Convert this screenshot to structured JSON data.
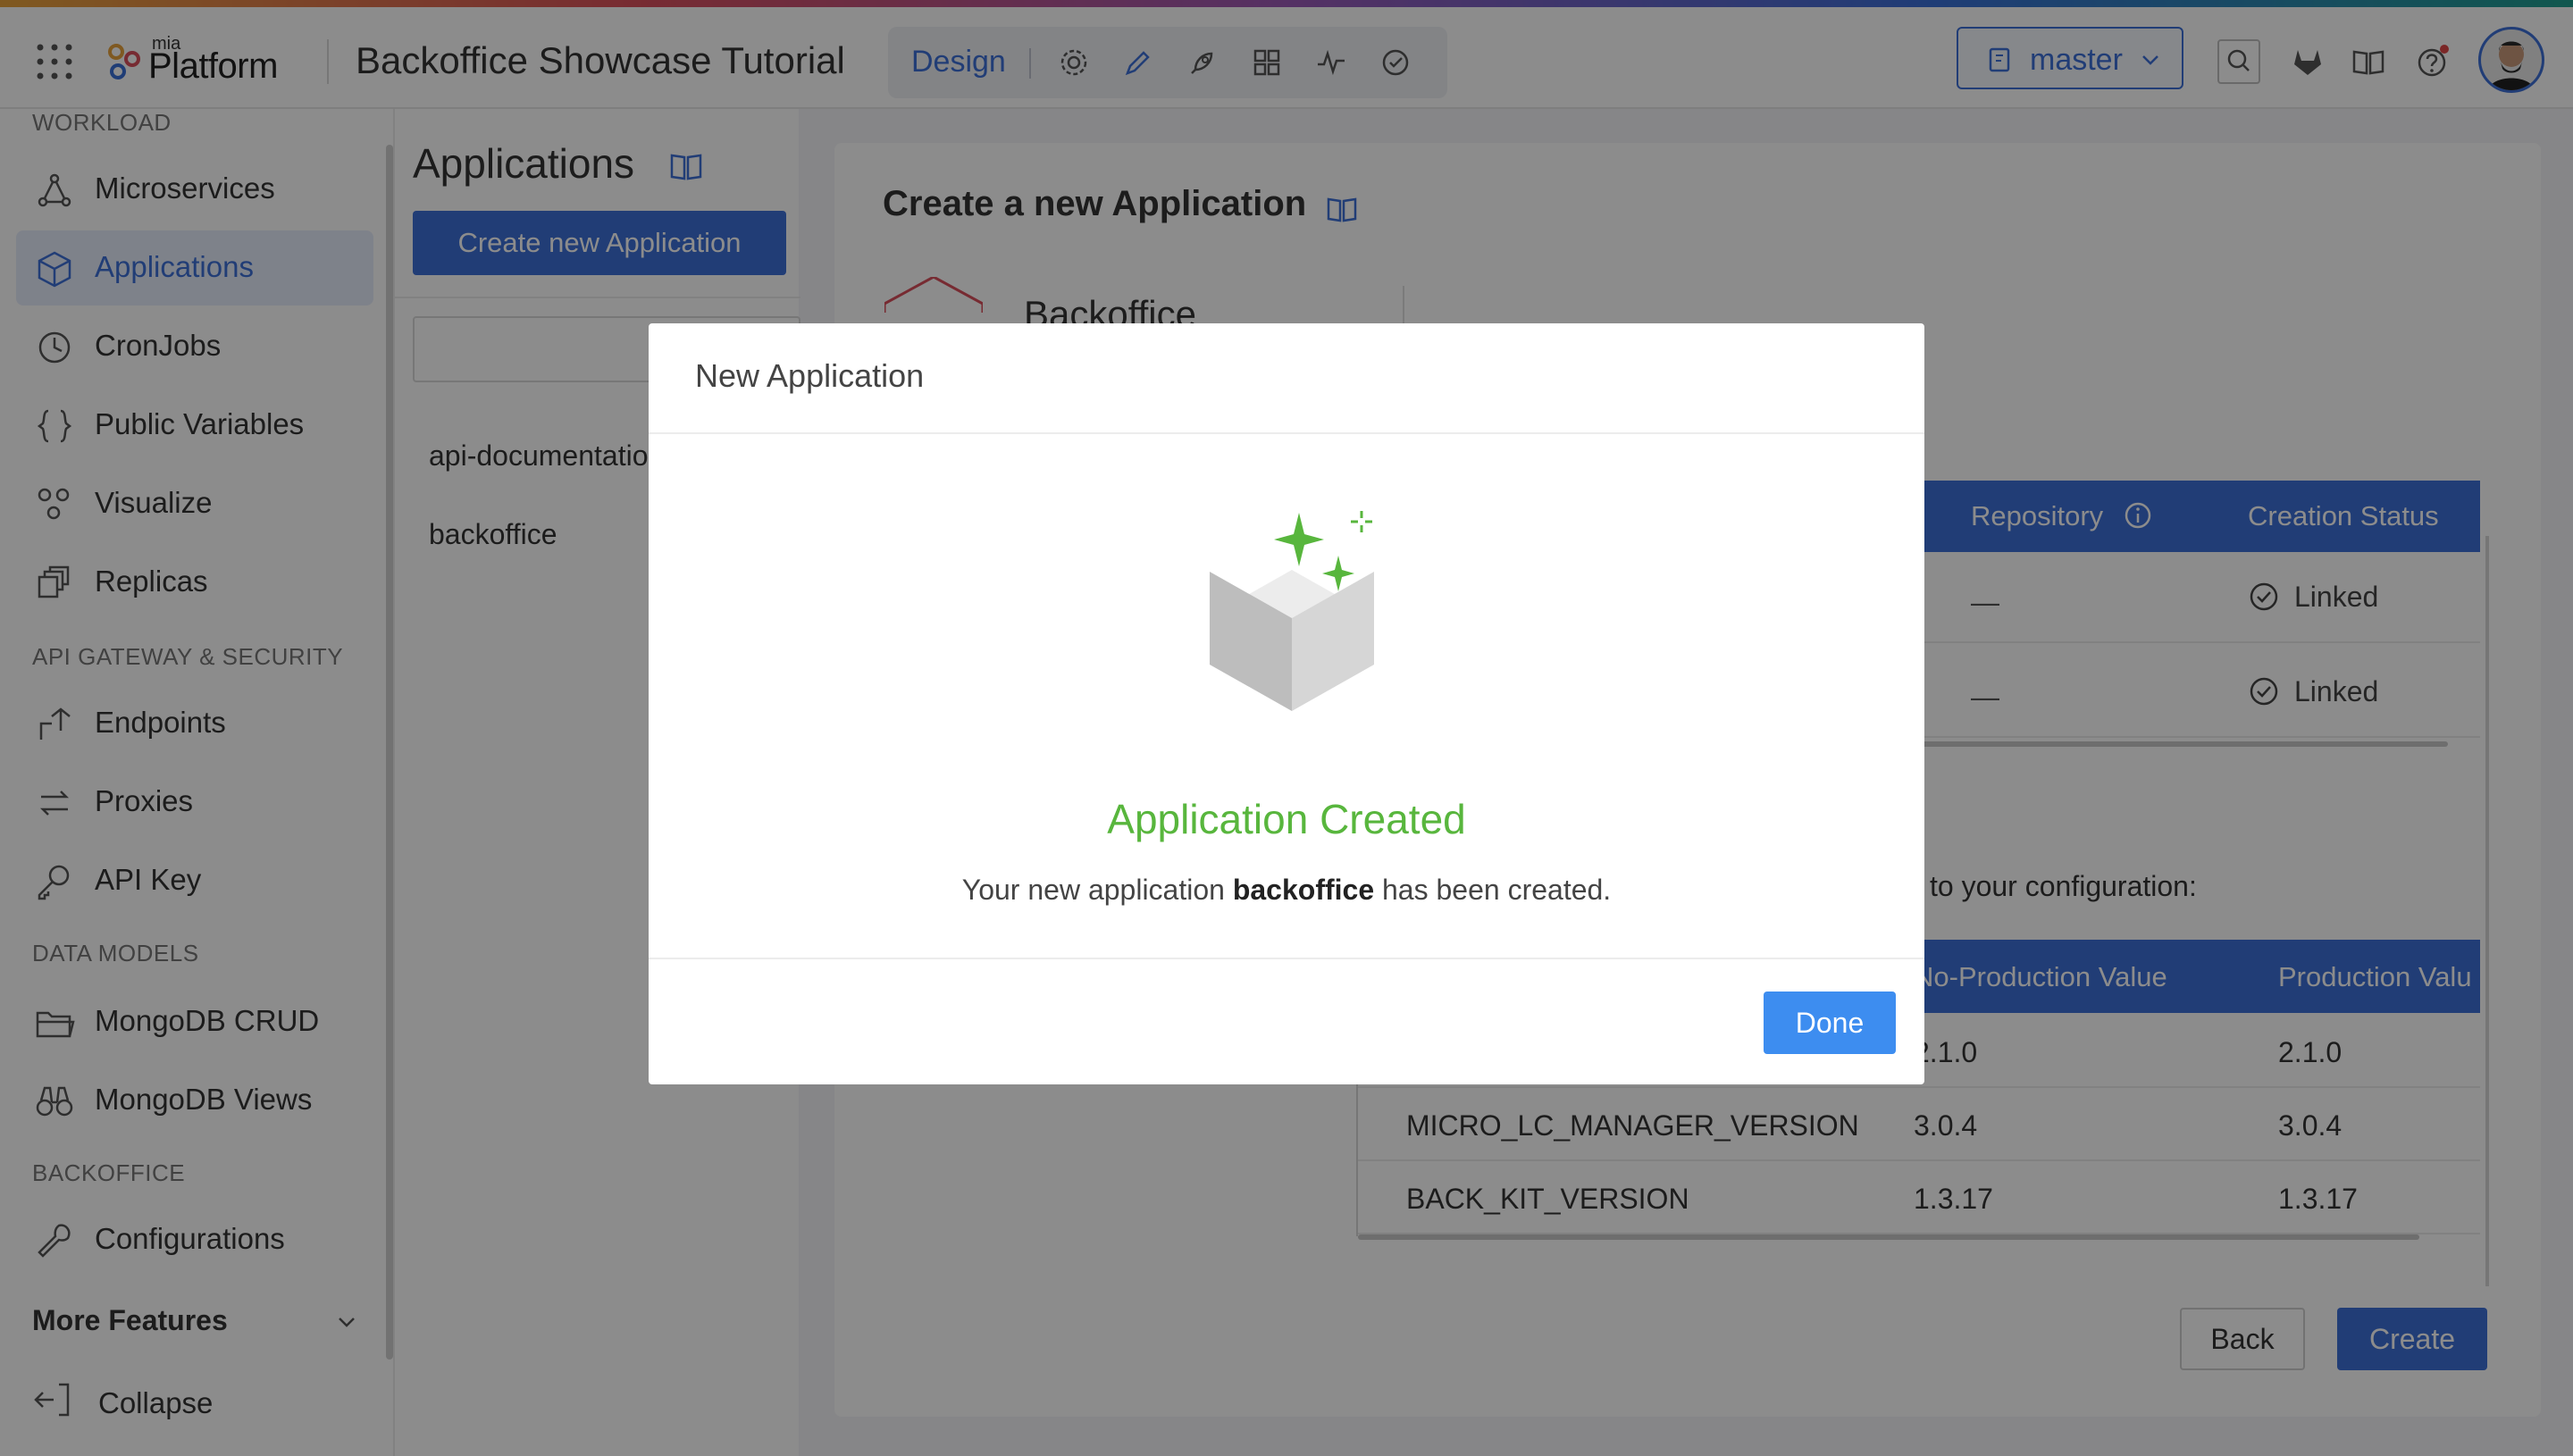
{
  "topbar": {
    "logo_small": "mia",
    "logo_text": "Platform",
    "project_title": "Backoffice Showcase Tutorial",
    "active_section": "Design",
    "branch": "master",
    "accent_color": "#3d6fd8"
  },
  "sidebar": {
    "sections": {
      "workload": "WORKLOAD",
      "api_gateway": "API GATEWAY & SECURITY",
      "data_models": "DATA MODELS",
      "backoffice": "BACKOFFICE"
    },
    "items": [
      {
        "label": "Microservices",
        "icon": "microservices-icon"
      },
      {
        "label": "Applications",
        "icon": "cube-icon",
        "active": true
      },
      {
        "label": "CronJobs",
        "icon": "clock-icon"
      },
      {
        "label": "Public Variables",
        "icon": "braces-icon"
      },
      {
        "label": "Visualize",
        "icon": "visualize-icon"
      },
      {
        "label": "Replicas",
        "icon": "replicas-icon"
      },
      {
        "label": "Endpoints",
        "icon": "endpoints-icon"
      },
      {
        "label": "Proxies",
        "icon": "proxies-icon"
      },
      {
        "label": "API Key",
        "icon": "key-icon"
      },
      {
        "label": "MongoDB CRUD",
        "icon": "folder-icon"
      },
      {
        "label": "MongoDB Views",
        "icon": "binoculars-icon"
      },
      {
        "label": "Configurations",
        "icon": "wrench-icon"
      }
    ],
    "more_features": "More Features",
    "collapse": "Collapse"
  },
  "apps_panel": {
    "title": "Applications",
    "create_button": "Create new Application",
    "items": [
      "api-documentatio",
      "backoffice"
    ]
  },
  "main": {
    "title": "Create a new Application",
    "app_name": "Backoffice",
    "repo_table": {
      "headers": [
        "Repository",
        "Creation Status"
      ],
      "rows": [
        {
          "repository": "—",
          "status": "Linked"
        },
        {
          "repository": "—",
          "status": "Linked"
        }
      ]
    },
    "config_text": "to your configuration:",
    "env_table": {
      "headers": [
        "No-Production Value",
        "Production Valu"
      ],
      "rows": [
        {
          "key": "",
          "noprod": "2.1.0",
          "prod": "2.1.0"
        },
        {
          "key": "MICRO_LC_MANAGER_VERSION",
          "noprod": "3.0.4",
          "prod": "3.0.4"
        },
        {
          "key": "BACK_KIT_VERSION",
          "noprod": "1.3.17",
          "prod": "1.3.17"
        }
      ]
    },
    "back_button": "Back",
    "create_button": "Create"
  },
  "modal": {
    "title": "New Application",
    "success_title": "Application Created",
    "message_before": "Your new application ",
    "message_app": "backoffice",
    "message_after": " has been created.",
    "done_button": "Done",
    "success_color": "#58b63d"
  }
}
